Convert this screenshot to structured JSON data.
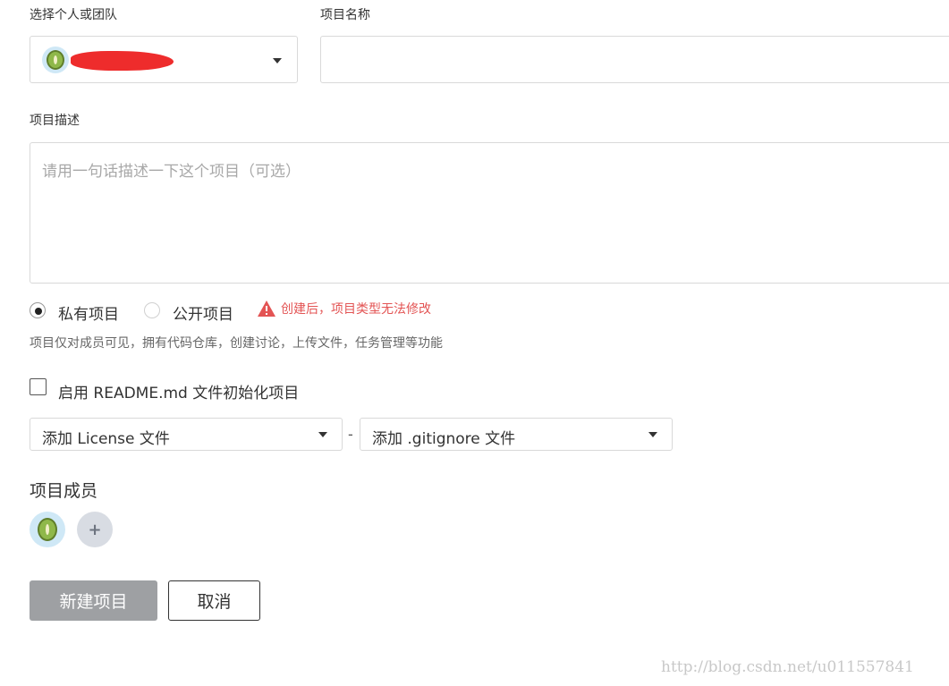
{
  "owner": {
    "label": "选择个人或团队",
    "selected_name": "",
    "avatar_icon": "kiwi-avatar-icon"
  },
  "project_name": {
    "label": "项目名称",
    "value": "",
    "placeholder": ""
  },
  "description": {
    "label": "项目描述",
    "placeholder": "请用一句话描述一下这个项目（可选）"
  },
  "visibility": {
    "private_label": "私有项目",
    "public_label": "公开项目",
    "selected": "private",
    "warning": "创建后，项目类型无法修改",
    "hint": "项目仅对成员可见，拥有代码仓库，创建讨论，上传文件，任务管理等功能"
  },
  "readme": {
    "label": "启用 README.md 文件初始化项目",
    "checked": false
  },
  "templates": {
    "license_label": "添加 License 文件",
    "separator": "-",
    "gitignore_label": "添加 .gitignore 文件"
  },
  "members": {
    "label": "项目成员",
    "add_symbol": "+"
  },
  "actions": {
    "create_label": "新建项目",
    "cancel_label": "取消"
  },
  "watermark": "http://blog.csdn.net/u011557841",
  "colors": {
    "warning": "#e35454",
    "primary_disabled": "#9ea0a3",
    "redaction": "#ee2c2c"
  }
}
